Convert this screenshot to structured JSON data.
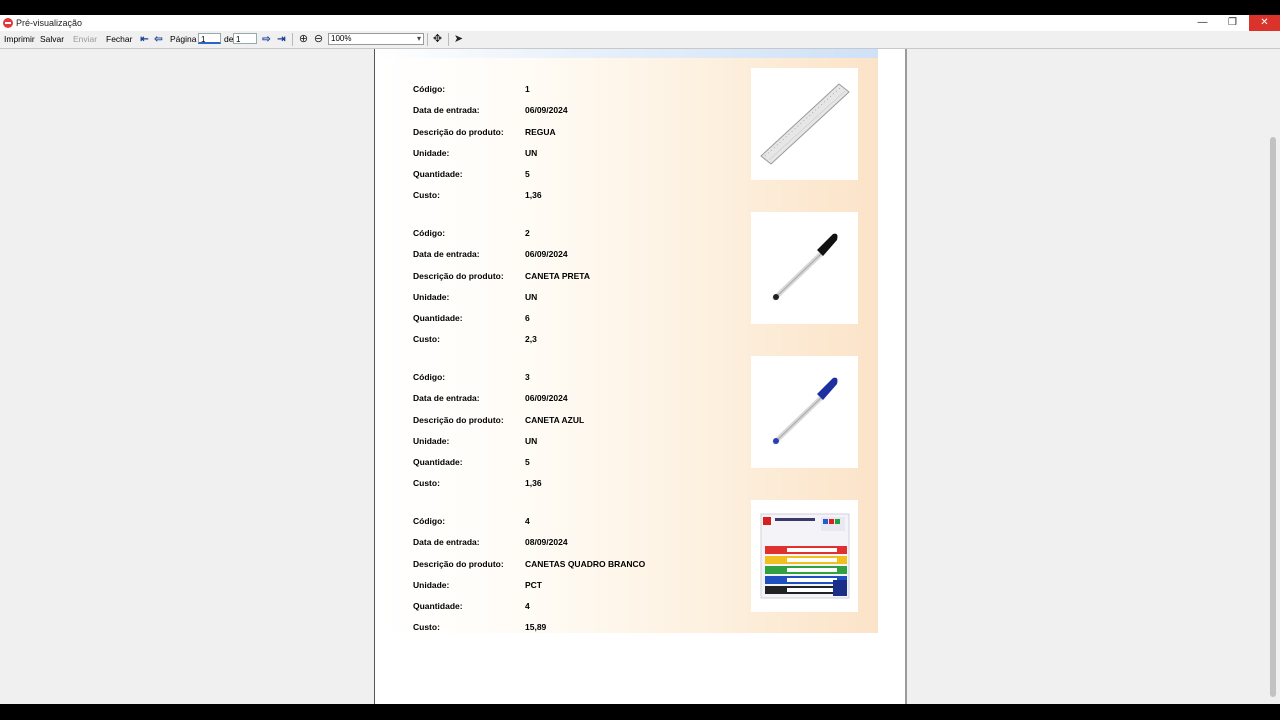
{
  "window": {
    "title": "Pré-visualização",
    "controls": {
      "minimize": "—",
      "maximize": "❐",
      "close": "✕"
    }
  },
  "toolbar": {
    "print_label": "Imprimir",
    "save_label": "Salvar",
    "send_label": "Enviar",
    "close_label": "Fechar",
    "page_label": "Página",
    "page_current": "1",
    "page_of_label": "de",
    "page_total": "1",
    "zoom": "100%"
  },
  "records": [
    {
      "labels": [
        "Código:",
        "Data de entrada:",
        "Descrição do produto:",
        "Unidade:",
        "Quantidade:",
        "Custo:"
      ],
      "codigo": "1",
      "data_entrada": "06/09/2024",
      "descricao": "REGUA",
      "unidade": "UN",
      "quantidade": "5",
      "custo": "1,36",
      "image_icon": "ruler-image"
    },
    {
      "labels": [
        "Código:",
        "Data de entrada:",
        "Descrição do produto:",
        "Unidade:",
        "Quantidade:",
        "Custo:"
      ],
      "codigo": "2",
      "data_entrada": "06/09/2024",
      "descricao": "CANETA PRETA",
      "unidade": "UN",
      "quantidade": "6",
      "custo": "2,3",
      "image_icon": "black-pen-image"
    },
    {
      "labels": [
        "Código:",
        "Data de entrada:",
        "Descrição do produto:",
        "Unidade:",
        "Quantidade:",
        "Custo:"
      ],
      "codigo": "3",
      "data_entrada": "06/09/2024",
      "descricao": "CANETA AZUL",
      "unidade": "UN",
      "quantidade": "5",
      "custo": "1,36",
      "image_icon": "blue-pen-image"
    },
    {
      "labels": [
        "Código:",
        "Data de entrada:",
        "Descrição do produto:",
        "Unidade:",
        "Quantidade:",
        "Custo:"
      ],
      "codigo": "4",
      "data_entrada": "08/09/2024",
      "descricao": "CANETAS QUADRO BRANCO",
      "unidade": "PCT",
      "quantidade": "4",
      "custo": "15,89",
      "image_icon": "whiteboard-markers-image"
    }
  ],
  "colors": {
    "close_button": "#d9332b",
    "band_gradient_end": "#fbe3c8",
    "header_band": "#cfe1f7"
  }
}
